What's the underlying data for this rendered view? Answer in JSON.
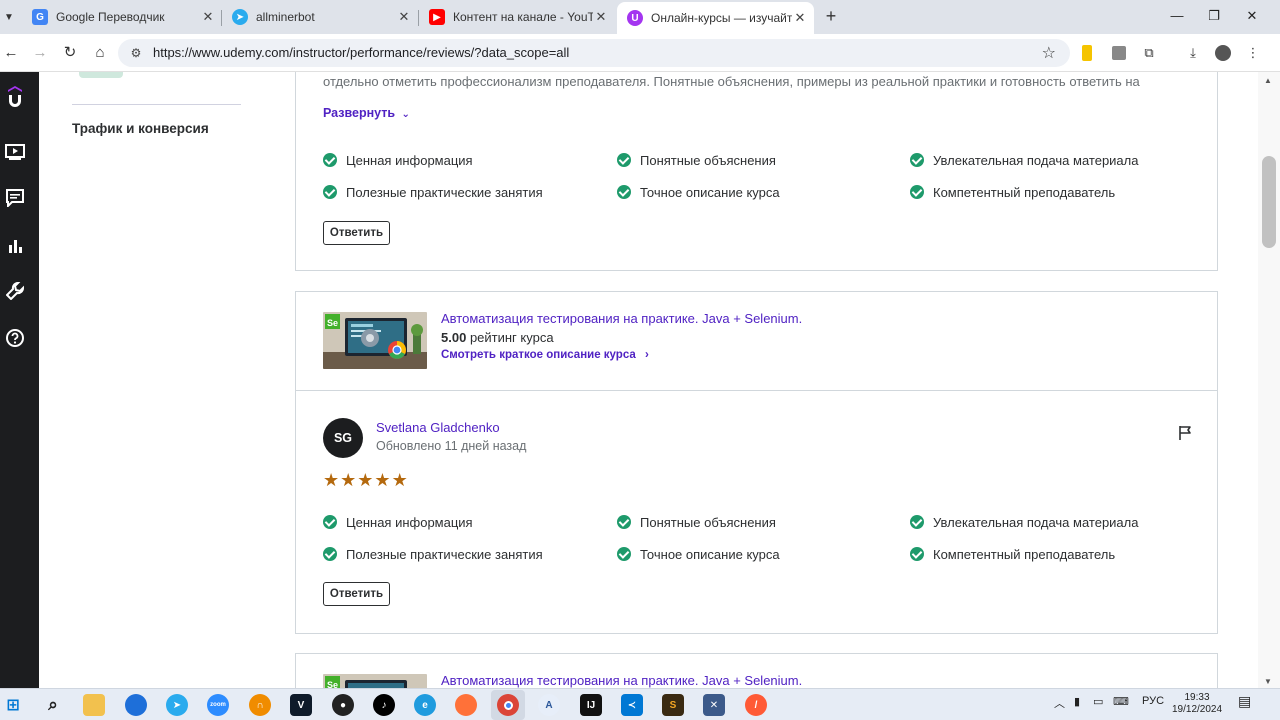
{
  "browser": {
    "tabs": [
      {
        "title": "Google Переводчик",
        "favicon": "google-translate-icon",
        "color": "#4285f4"
      },
      {
        "title": "allminerbot",
        "favicon": "telegram-icon",
        "color": "#2aabee"
      },
      {
        "title": "Контент на канале - YouTube S",
        "favicon": "youtube-icon",
        "color": "#ff0000"
      },
      {
        "title": "Онлайн-курсы — изучайте лю",
        "favicon": "udemy-icon",
        "color": "#a435f0",
        "active": true
      }
    ],
    "url": "https://www.udemy.com/instructor/performance/reviews/?data_scope=all"
  },
  "sidebar": {
    "nav_label": "Трафик и конверсия"
  },
  "review_top": {
    "snippet": "отдельно отметить профессионализм преподавателя. Понятные объяснения, примеры из реальной практики и готовность ответить на",
    "expand_label": "Развернуть",
    "tags": [
      "Ценная информация",
      "Понятные объяснения",
      "Увлекательная подача материала",
      "Полезные практические занятия",
      "Точное описание курса",
      "Компетентный преподаватель"
    ],
    "reply_label": "Ответить"
  },
  "course": {
    "title": "Автоматизация тестирования на практике. Java + Selenium.",
    "rating_value": "5.00",
    "rating_label": "рейтинг курса",
    "overview_link": "Смотреть краткое описание курса"
  },
  "review": {
    "initials": "SG",
    "name": "Svetlana Gladchenko",
    "updated": "Обновлено 11 дней назад",
    "rating": 5,
    "tags": [
      "Ценная информация",
      "Понятные объяснения",
      "Увлекательная подача материала",
      "Полезные практические занятия",
      "Точное описание курса",
      "Компетентный преподаватель"
    ],
    "reply_label": "Ответить"
  },
  "course_next": {
    "title": "Автоматизация тестирования на практике. Java + Selenium."
  },
  "taskbar": {
    "lang": "РУС",
    "time": "19:33",
    "date": "19/12/2024"
  },
  "colors": {
    "accent": "#5022c3",
    "check": "#1e9a6b",
    "star": "#b4690e",
    "rail": "#1c1d1f"
  }
}
